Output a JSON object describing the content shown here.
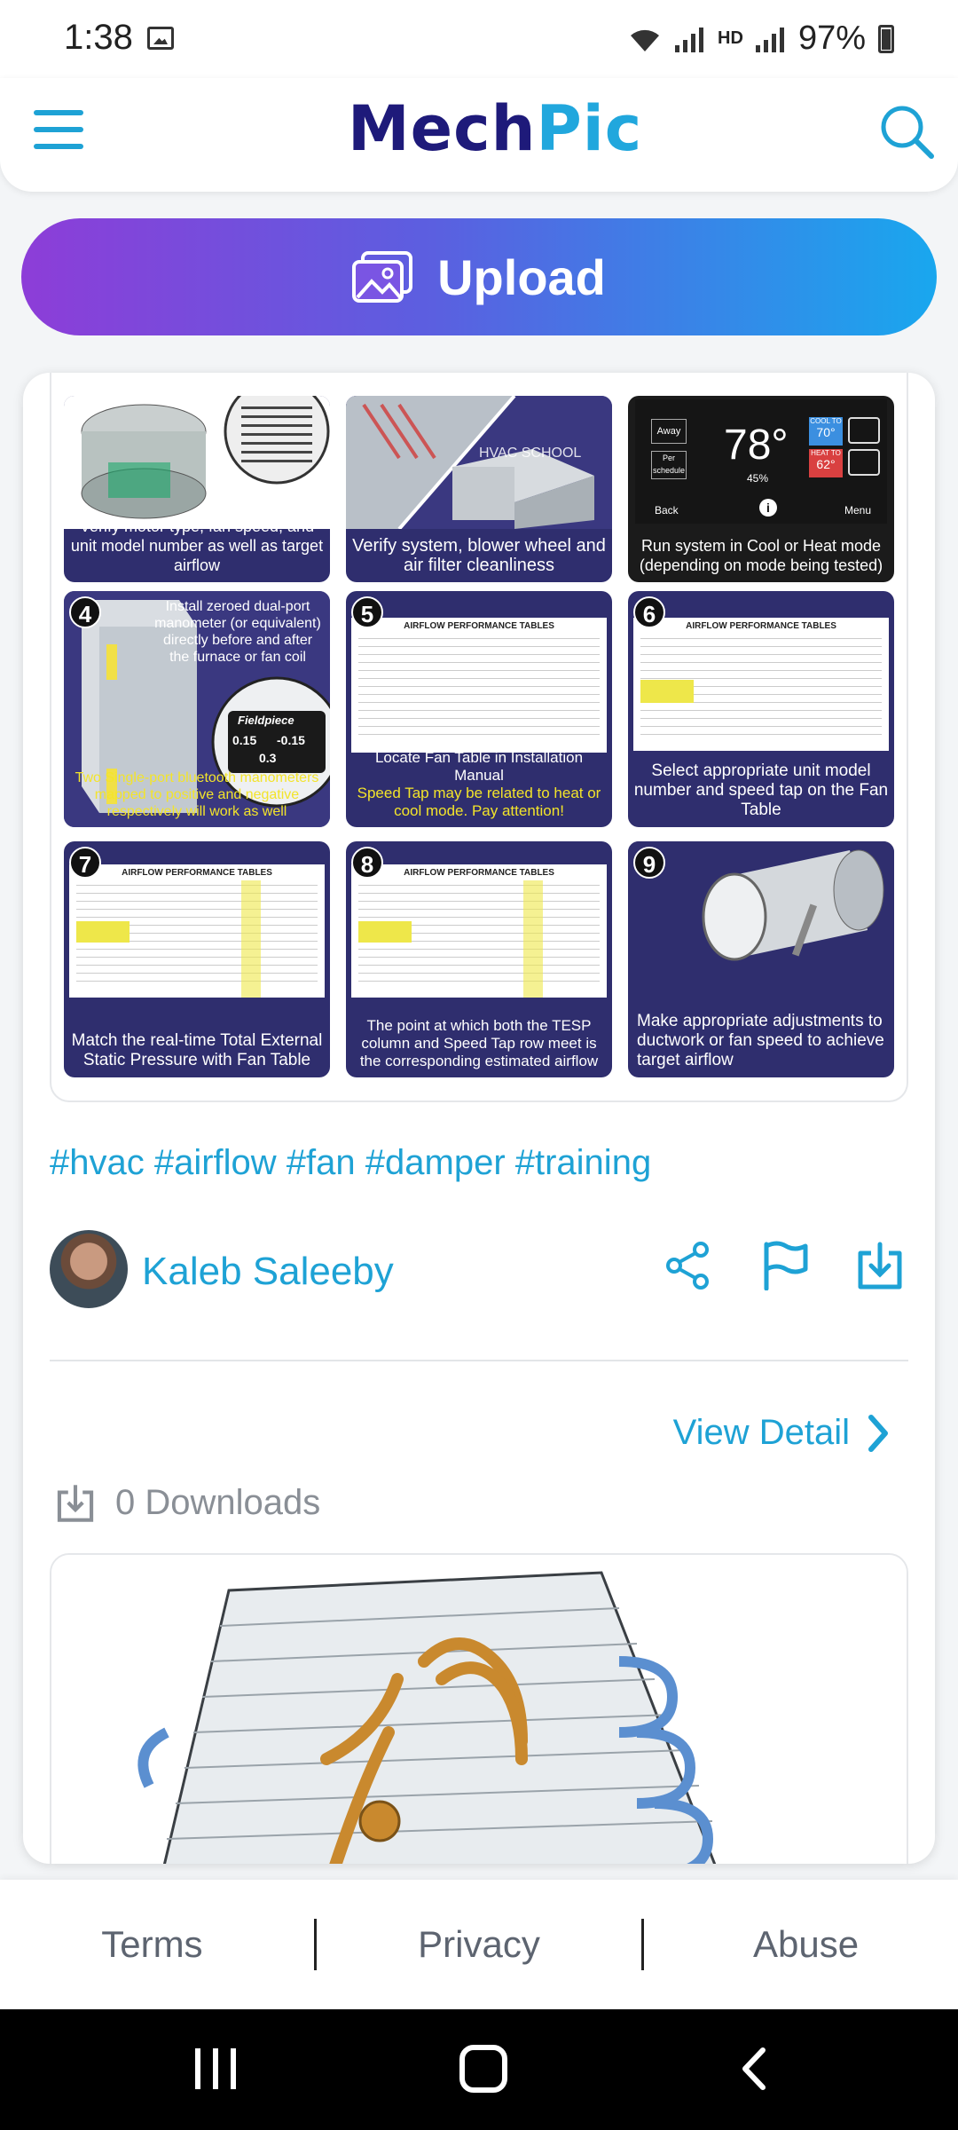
{
  "status_bar": {
    "time": "1:38",
    "battery": "97%",
    "network_label": "HD"
  },
  "header": {
    "logo_part1": "Mech",
    "logo_part2": "Pic"
  },
  "upload": {
    "label": "Upload"
  },
  "post": {
    "panels": [
      {
        "number": "",
        "caption": "Verify motor type, fan speed, and unit model number as well as target airflow"
      },
      {
        "number": "",
        "caption": "Verify system, blower wheel and air filter cleanliness",
        "overlay": "HVAC SCHOOL"
      },
      {
        "number": "",
        "caption": "Run system in Cool or Heat mode (depending on mode being tested)",
        "thermo_temp": "78°",
        "thermo_humidity": "45%",
        "thermo_back": "Back",
        "thermo_menu": "Menu",
        "thermo_away": "Away",
        "thermo_sched": "Per schedule",
        "cool_to": "COOL TO",
        "cool_val": "70°",
        "heat_to": "HEAT TO",
        "heat_val": "62°"
      },
      {
        "number": "4",
        "caption_top": "Install zeroed dual-port manometer (or equivalent) directly before and after the furnace or fan coil",
        "caption": "Two Single-port bluetooth manometers mapped to positive and negative respectively will work as well",
        "brand": "Fieldpiece",
        "reading1": "0.15",
        "reading2": "-0.15",
        "reading3": "0.3"
      },
      {
        "number": "5",
        "table_title": "AIRFLOW PERFORMANCE TABLES",
        "caption_white": "Locate Fan Table in Installation Manual",
        "caption_yellow": "Speed Tap may be related to heat or cool mode. Pay attention!"
      },
      {
        "number": "6",
        "table_title": "AIRFLOW PERFORMANCE TABLES",
        "caption": "Select appropriate unit model number and speed tap on the Fan Table"
      },
      {
        "number": "7",
        "table_title": "AIRFLOW PERFORMANCE TABLES",
        "caption": "Match the real-time Total External Static Pressure with Fan Table"
      },
      {
        "number": "8",
        "table_title": "AIRFLOW PERFORMANCE TABLES",
        "caption": "The point at which both the TESP column and Speed Tap row meet is the corresponding estimated airflow"
      },
      {
        "number": "9",
        "caption": "Make appropriate adjustments to ductwork or fan speed to achieve target airflow"
      }
    ],
    "tags": "#hvac #airflow #fan #damper #training",
    "author": "Kaleb Saleeby",
    "view_detail": "View Detail",
    "downloads": "0 Downloads"
  },
  "footer": {
    "terms": "Terms",
    "privacy": "Privacy",
    "abuse": "Abuse"
  },
  "colors": {
    "accent": "#1ea2d5",
    "brand_dark": "#1e1a7a",
    "panel_bg": "#2f2e6e",
    "upload_gradient_start": "#8d3dd8",
    "upload_gradient_end": "#19a7ee"
  },
  "icons": {
    "menu": "hamburger-icon",
    "search": "search-icon",
    "upload": "image-upload-icon",
    "share": "share-icon",
    "flag": "flag-icon",
    "download": "download-icon",
    "chevron": "chevron-right-icon"
  }
}
